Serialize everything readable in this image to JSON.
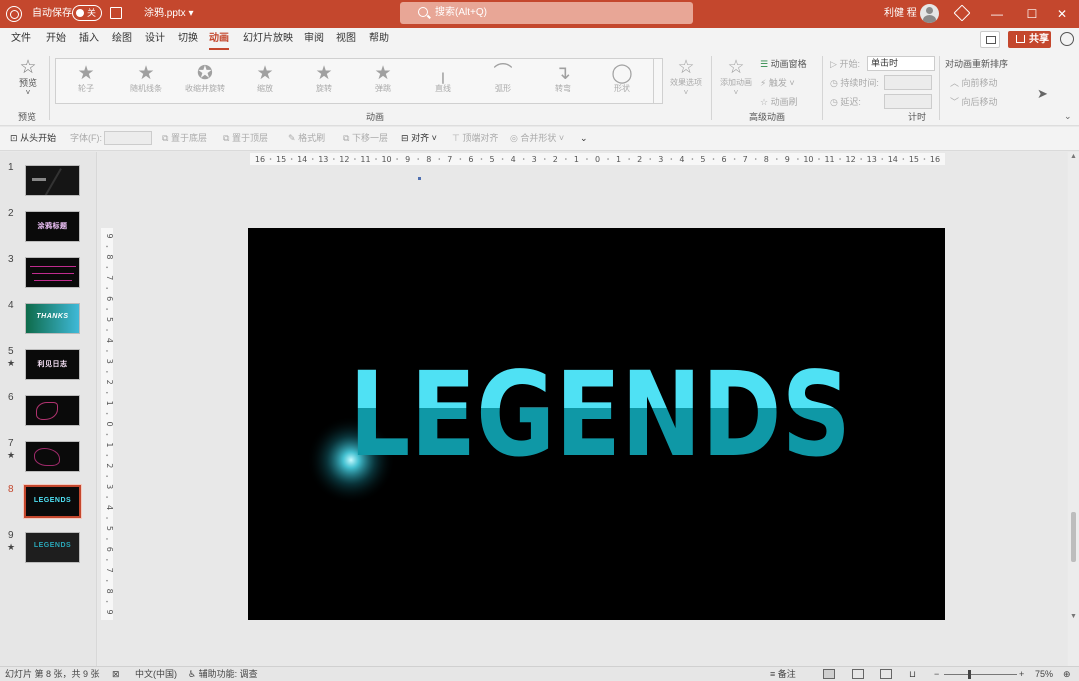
{
  "titlebar": {
    "autosave_label": "自动保存",
    "autosave_state": "关",
    "filename": "涂鸦.pptx ▾",
    "search_placeholder": "搜索(Alt+Q)",
    "user_name": "利健 程",
    "minimize": "—",
    "restore": "☐",
    "close": "✕"
  },
  "menubar": {
    "items": [
      "文件",
      "开始",
      "插入",
      "绘图",
      "设计",
      "切换",
      "动画",
      "幻灯片放映",
      "审阅",
      "视图",
      "帮助"
    ],
    "active": "动画",
    "share_label": "共享"
  },
  "ribbon": {
    "preview_label": "预览",
    "preview_group": "预览",
    "effects": [
      "轮子",
      "随机线条",
      "收缩并旋转",
      "缩放",
      "旋转",
      "弹跳",
      "直线",
      "弧形",
      "转弯",
      "形状"
    ],
    "effect_options": "效果选项",
    "animation_group": "动画",
    "add_animation": "添加动画",
    "animation_pane": "动画窗格",
    "trigger": "触发 ˅",
    "animation_painter": "动画刷",
    "advanced_group": "高级动画",
    "start_label": "开始:",
    "start_value": "单击时",
    "duration_label": "持续时间:",
    "delay_label": "延迟:",
    "timing_group": "计时",
    "reorder_title": "对动画重新排序",
    "move_earlier": "向前移动",
    "move_later": "向后移动"
  },
  "quick_toolbar": {
    "from_start": "从头开始",
    "font_label": "字体(F):",
    "bring_forward": "置于底层",
    "bring_front": "置于顶层",
    "format_painter": "格式刷",
    "send_back": "下移一层",
    "align": "对齐 ˅",
    "align_top": "顶端对齐",
    "merge_shapes": "合并形状 ˅",
    "more": "⌄"
  },
  "thumbnails": [
    {
      "num": "1",
      "text": "",
      "starred": false
    },
    {
      "num": "2",
      "text": "涂鸦标题",
      "starred": false
    },
    {
      "num": "3",
      "text": "",
      "starred": false
    },
    {
      "num": "4",
      "text": "THANKS",
      "starred": false
    },
    {
      "num": "5",
      "text": "利见日志",
      "starred": true
    },
    {
      "num": "6",
      "text": "",
      "starred": false
    },
    {
      "num": "7",
      "text": "",
      "starred": true
    },
    {
      "num": "8",
      "text": "LEGENDS",
      "starred": false
    },
    {
      "num": "9",
      "text": "LEGENDS",
      "starred": true
    }
  ],
  "active_slide": 8,
  "slide": {
    "title": "LEGENDS",
    "top_color": "#4fe1f4",
    "bottom_color": "#0f98a6"
  },
  "ruler": {
    "h_labels": [
      "16",
      "15",
      "14",
      "13",
      "12",
      "11",
      "10",
      "9",
      "8",
      "7",
      "6",
      "5",
      "4",
      "3",
      "2",
      "1",
      "0",
      "1",
      "2",
      "3",
      "4",
      "5",
      "6",
      "7",
      "8",
      "9",
      "10",
      "11",
      "12",
      "13",
      "14",
      "15",
      "16"
    ],
    "v_labels": [
      "9",
      "8",
      "7",
      "6",
      "5",
      "4",
      "3",
      "2",
      "1",
      "0",
      "1",
      "2",
      "3",
      "4",
      "5",
      "6",
      "7",
      "8",
      "9"
    ]
  },
  "statusbar": {
    "slide_info": "幻灯片 第 8 张，共 9 张",
    "language": "中文(中国)",
    "accessibility": "辅助功能: 调查",
    "notes": "备注",
    "zoom_minus": "−",
    "zoom_plus": "+",
    "zoom": "75%"
  }
}
